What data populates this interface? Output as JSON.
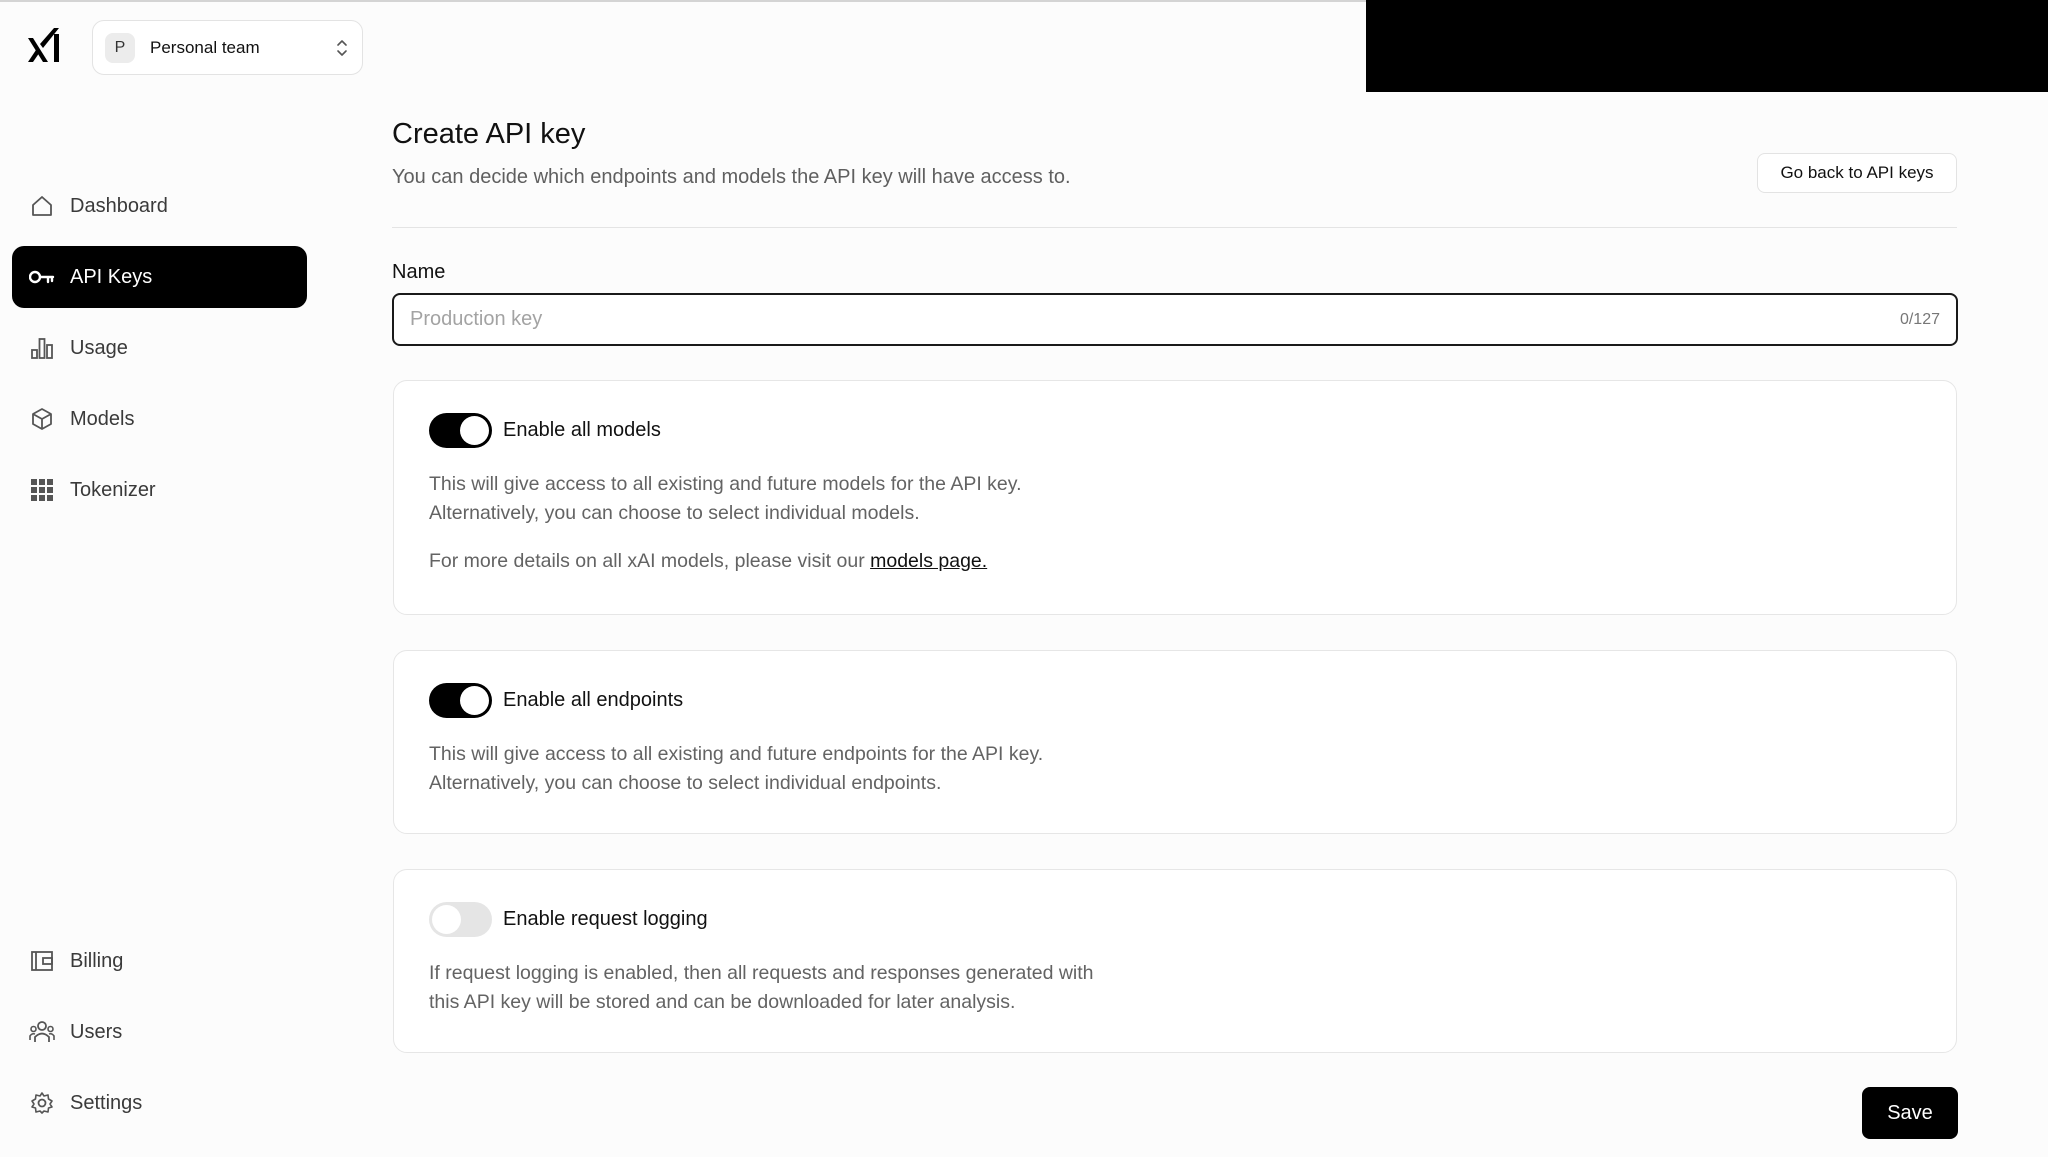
{
  "team": {
    "initial": "P",
    "name": "Personal team"
  },
  "nav": {
    "top": [
      {
        "label": "Dashboard",
        "icon": "home-icon",
        "active": false
      },
      {
        "label": "API Keys",
        "icon": "key-icon",
        "active": true
      },
      {
        "label": "Usage",
        "icon": "bar-chart-icon",
        "active": false
      },
      {
        "label": "Models",
        "icon": "cube-icon",
        "active": false
      },
      {
        "label": "Tokenizer",
        "icon": "grid-icon",
        "active": false
      }
    ],
    "bottom": [
      {
        "label": "Billing",
        "icon": "wallet-icon"
      },
      {
        "label": "Users",
        "icon": "users-icon"
      },
      {
        "label": "Settings",
        "icon": "gear-icon"
      }
    ]
  },
  "main": {
    "title": "Create API key",
    "subtitle": "You can decide which endpoints and models the API key will have access to.",
    "back_button": "Go back to API keys",
    "name_label": "Name",
    "name_placeholder": "Production key",
    "name_value": "",
    "name_counter": "0/127",
    "save_button": "Save"
  },
  "cards": {
    "models": {
      "title": "Enable all models",
      "enabled": true,
      "desc_line1": "This will give access to all existing and future models for the API key.",
      "desc_line2": "Alternatively, you can choose to select individual models.",
      "details_prefix": "For more details on all xAI models, please visit our",
      "details_link": "models page."
    },
    "endpoints": {
      "title": "Enable all endpoints",
      "enabled": true,
      "desc_line1": "This will give access to all existing and future endpoints for the API key.",
      "desc_line2": "Alternatively, you can choose to select individual endpoints."
    },
    "logging": {
      "title": "Enable request logging",
      "enabled": false,
      "desc_line1": "If request logging is enabled, then all requests and responses generated with",
      "desc_line2": "this API key will be stored and can be downloaded for later analysis."
    }
  },
  "colors": {
    "accent": "#000000",
    "muted_text": "#636363",
    "border": "#e6e6e6"
  }
}
